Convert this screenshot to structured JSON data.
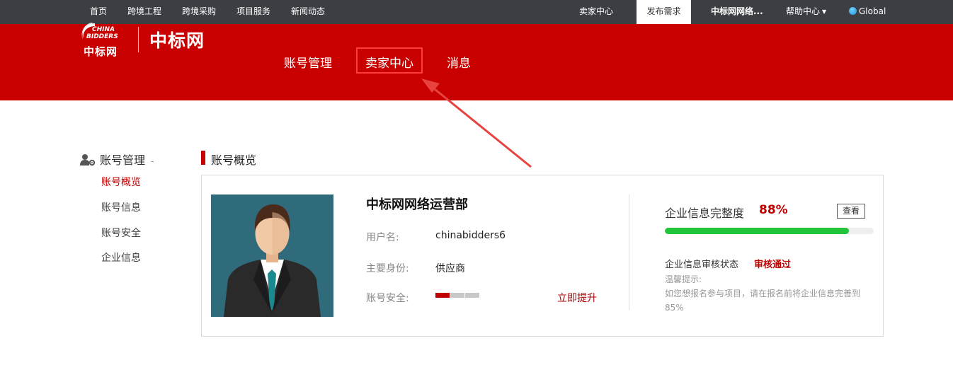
{
  "topbar": {
    "links": [
      "首页",
      "跨境工程",
      "跨境采购",
      "项目服务",
      "新闻动态"
    ],
    "seller_center": "卖家中心",
    "publish": "发布需求",
    "company": "中标网网络...",
    "help": "帮助中心",
    "global": "Global"
  },
  "header": {
    "logo_text_en1": "CHINA",
    "logo_text_en2": "BIDDERS",
    "logo_cn_small": "中标网",
    "logo_cn_big": "中标网",
    "nav": [
      "账号管理",
      "卖家中心",
      "消息"
    ]
  },
  "sidebar": {
    "heading": "账号管理",
    "collapse": "-",
    "items": [
      "账号概览",
      "账号信息",
      "账号安全",
      "企业信息"
    ]
  },
  "main": {
    "section_title": "账号概览",
    "company_name": "中标网网络运营部",
    "username_label": "用户名:",
    "username": "chinabidders6",
    "role_label": "主要身份:",
    "role": "供应商",
    "security_label": "账号安全:",
    "security_level": 1,
    "security_max": 3,
    "upgrade": "立即提升",
    "completeness_label": "企业信息完整度",
    "completeness_pct_text": "88%",
    "completeness_value": 0.88,
    "view_button": "查看",
    "audit_label": "企业信息审核状态",
    "audit_status": "审核通过",
    "tip_title": "温馨提示:",
    "tip_text": "如您想报名参与项目，请在报名前将企业信息完善到85%"
  },
  "colors": {
    "header_red": "#c90000",
    "topbar_dark": "#3b3e42",
    "accent_red": "#c00000",
    "progress_green": "#22c53a",
    "avatar_bg": "#2f6b7a"
  }
}
